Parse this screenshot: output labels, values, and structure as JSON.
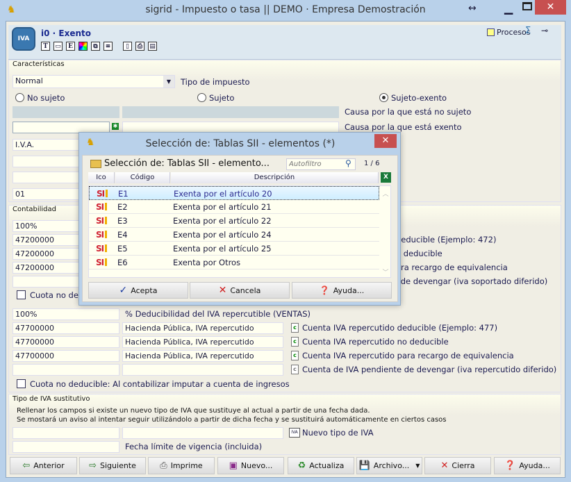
{
  "window": {
    "title": "sigrid - Impuesto o tasa || DEMO · Empresa Demostración"
  },
  "header": {
    "title": "i0 · Exento",
    "procesos": "Procesos",
    "toolbar_icons": [
      "text-T-icon",
      "comment-icon",
      "E-icon",
      "color-wheel-icon",
      "tag-icon",
      "notice-icon",
      "preview-icon",
      "print-icon",
      "pdf-icon"
    ]
  },
  "caracteristicas": {
    "section": "Características",
    "tipo_value": "Normal",
    "tipo_label": "Tipo de impuesto",
    "radios": [
      {
        "label": "No sujeto",
        "checked": false
      },
      {
        "label": "Sujeto",
        "checked": false
      },
      {
        "label": "Sujeto-exento",
        "checked": true
      }
    ],
    "causa_no_sujeto": "Causa por la que está no sujeto",
    "causa_exento": "Causa por la que está exento",
    "iva_value": "I.V.A.",
    "code_value": "01"
  },
  "contabilidad": {
    "section": "Contabilidad",
    "soportado": {
      "pct": "100%",
      "rows": [
        {
          "code": "47200000",
          "label": "deducible (Ejemplo: 472)"
        },
        {
          "code": "47200000",
          "label": "o deducible"
        },
        {
          "code": "47200000",
          "label": "ara recargo de equivalencia"
        },
        {
          "code": "",
          "label": "e de devengar (iva soportado diferido)"
        }
      ],
      "cuota": "Cuota no de"
    },
    "repercutido": {
      "pct": "100%",
      "pct_label": "% Deducibilidad del IVA repercutible (VENTAS)",
      "rows": [
        {
          "code": "47700000",
          "name": "Hacienda Pública, IVA repercutido",
          "label": "Cuenta IVA repercutido deducible (Ejemplo: 477)"
        },
        {
          "code": "47700000",
          "name": "Hacienda Pública, IVA repercutido",
          "label": "Cuenta IVA repercutido no deducible"
        },
        {
          "code": "47700000",
          "name": "Hacienda Pública, IVA repercutido",
          "label": "Cuenta IVA repercutido para recargo de equivalencia"
        },
        {
          "code": "",
          "name": "",
          "label": "Cuenta de IVA pendiente de devengar (iva repercutido diferido)"
        }
      ],
      "cuota": "Cuota no deducible: Al contabilizar imputar a cuenta de ingresos"
    }
  },
  "sustitutivo": {
    "section": "Tipo de IVA sustitutivo",
    "line1": "Rellenar los campos si existe un nuevo tipo de IVA que sustituye al actual a partir de una fecha dada.",
    "line2": "Se mostará un aviso al intentar seguir utilizándolo a partir de dicha fecha y se sustituirá automáticamente en ciertos casos",
    "nuevo_label": "Nuevo tipo de IVA",
    "fecha_label": "Fecha límite de vigencia (incluida)"
  },
  "buttons": [
    "Anterior",
    "Siguiente",
    "Imprime",
    "Nuevo...",
    "Actualiza",
    "Archivo...",
    "Cierra",
    "Ayuda..."
  ],
  "modal": {
    "title": "Selección de: Tablas SII - elementos (*)",
    "heading": "Selección de: Tablas SII - elemento...",
    "filter_placeholder": "Autofiltro",
    "page": "1 / 6",
    "columns": [
      "Ico",
      "Código",
      "Descripción"
    ],
    "rows": [
      {
        "code": "E1",
        "desc": "Exenta por el artículo 20",
        "selected": true
      },
      {
        "code": "E2",
        "desc": "Exenta por el artículo 21"
      },
      {
        "code": "E3",
        "desc": "Exenta por el artículo 22"
      },
      {
        "code": "E4",
        "desc": "Exenta por el artículo 24"
      },
      {
        "code": "E5",
        "desc": "Exenta por el artículo 25"
      },
      {
        "code": "E6",
        "desc": "Exenta por Otros"
      }
    ],
    "icon_text": "SI",
    "buttons": {
      "accept": "Acepta",
      "cancel": "Cancela",
      "help": "Ayuda..."
    }
  }
}
